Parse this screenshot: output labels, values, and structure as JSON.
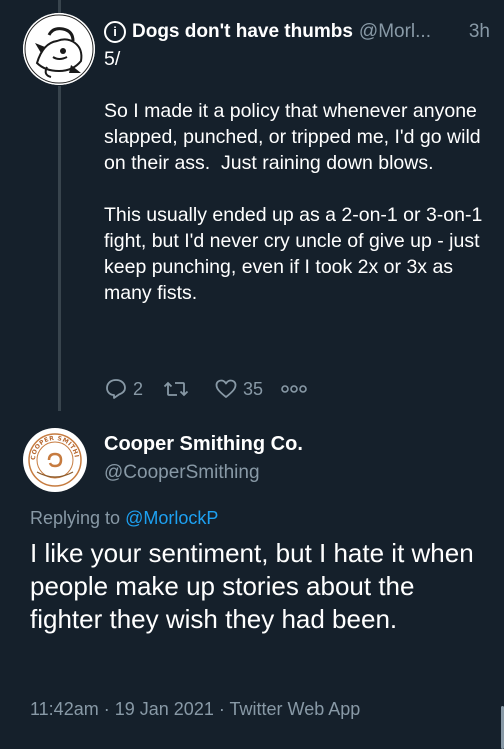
{
  "tweet": {
    "author_name": "Dogs don't have thumbs",
    "handle": "@Morl...",
    "time": "3h",
    "text": "5/\n\nSo I made it a policy that whenever anyone slapped, punched, or tripped me, I'd go wild on their ass.  Just raining down blows.\n\nThis usually ended up as a 2-on-1 or 3-on-1  fight, but I'd never cry uncle of give up - just keep punching, even if I took 2x or 3x as many fists.",
    "replies": "2",
    "retweets": "",
    "likes": "35"
  },
  "reply": {
    "author_name": "Cooper Smithing Co.",
    "handle": "@CooperSmithing",
    "avatar_text": "COOPER SMITHING CO",
    "replying_prefix": "Replying to",
    "replying_to": "@MorlockP",
    "text": "I like your sentiment, but I hate it when people make up stories about the fighter they wish they had been.",
    "timestamp": "11:42am",
    "date": "19 Jan 2021",
    "source": "Twitter Web App",
    "separator": "·"
  },
  "colors": {
    "background": "#15202b",
    "secondary_text": "#8899a6",
    "link": "#1da1f2"
  }
}
